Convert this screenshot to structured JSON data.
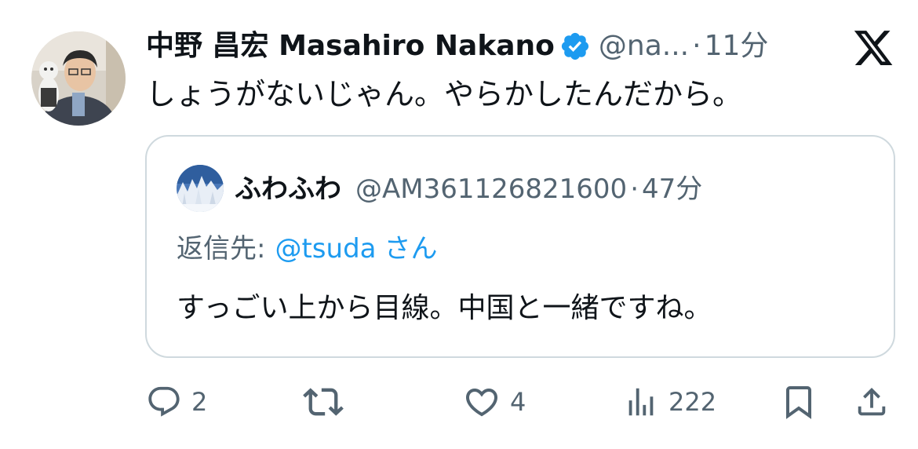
{
  "tweet": {
    "display_name": "中野 昌宏 Masahiro Nakano",
    "handle": "@na...",
    "separator": "·",
    "time": "11分",
    "text": "しょうがないじゃん。やらかしたんだから。",
    "verified": true
  },
  "quote": {
    "display_name": "ふわふわ",
    "handle": "@AM361126821600",
    "separator": "·",
    "time": "47分",
    "reply_prefix": "返信先:",
    "reply_mention": "@tsuda",
    "reply_suffix": "さん",
    "text": "すっごい上から目線。中国と一緒ですね。"
  },
  "actions": {
    "replies": "2",
    "likes": "4",
    "views": "222"
  },
  "colors": {
    "text_primary": "#0f1419",
    "text_secondary": "#536471",
    "accent": "#1d9bf0",
    "border": "#cfd9de"
  },
  "icons": [
    "x-logo-icon",
    "verified-badge-icon",
    "reply-icon",
    "retweet-icon",
    "like-icon",
    "views-icon",
    "bookmark-icon",
    "share-icon"
  ]
}
